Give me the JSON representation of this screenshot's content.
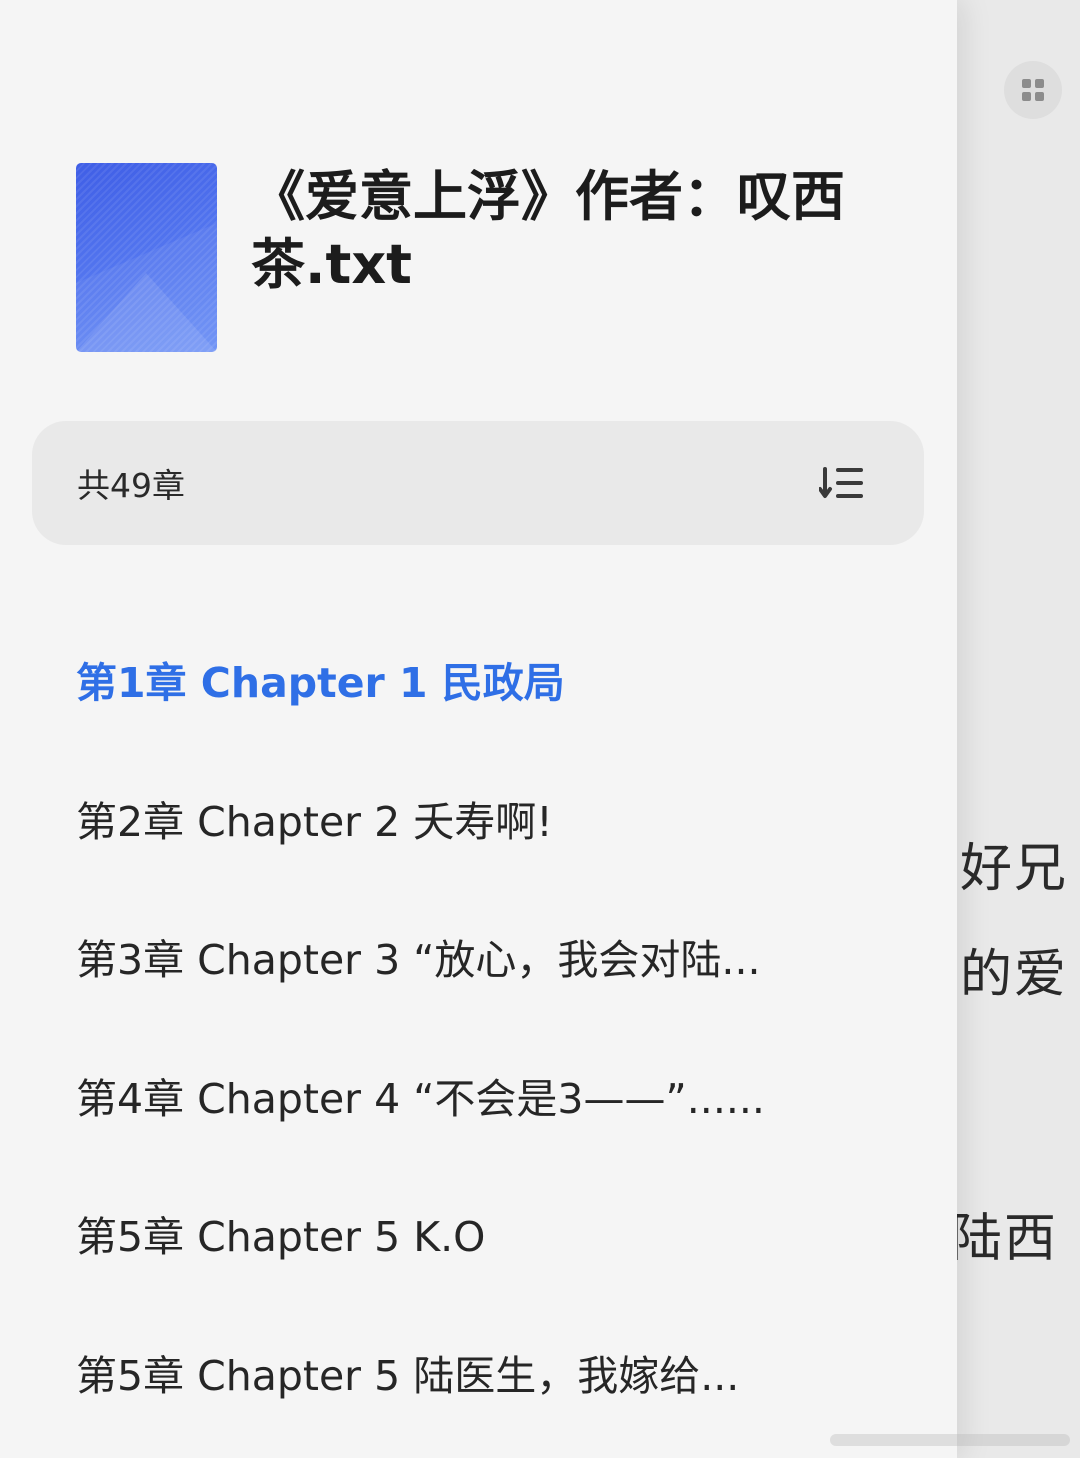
{
  "book": {
    "title": "《爱意上浮》作者：叹西茶.txt"
  },
  "toc": {
    "chapter_count": "共49章",
    "sort_icon": "sort-list-icon",
    "chapters": [
      {
        "label": "第1章 Chapter 1 民政局",
        "active": true
      },
      {
        "label": "第2章 Chapter 2 夭寿啊!",
        "active": false
      },
      {
        "label": "第3章 Chapter 3 “放心，我会对陆...",
        "active": false
      },
      {
        "label": "第4章 Chapter 4 “不会是3——”......",
        "active": false
      },
      {
        "label": "第5章 Chapter 5 K.O",
        "active": false
      },
      {
        "label": "第5章 Chapter 5 陆医生，我嫁给...",
        "active": false
      }
    ]
  },
  "reader": {
    "lines": [
      "好兄",
      "的爱",
      "陆西"
    ]
  },
  "toolbar": {
    "grid_icon": "grid-icon"
  },
  "colors": {
    "accent": "#2f6fe6",
    "cover_blue": "#4a6cf0",
    "panel_bg": "#f5f5f5"
  }
}
